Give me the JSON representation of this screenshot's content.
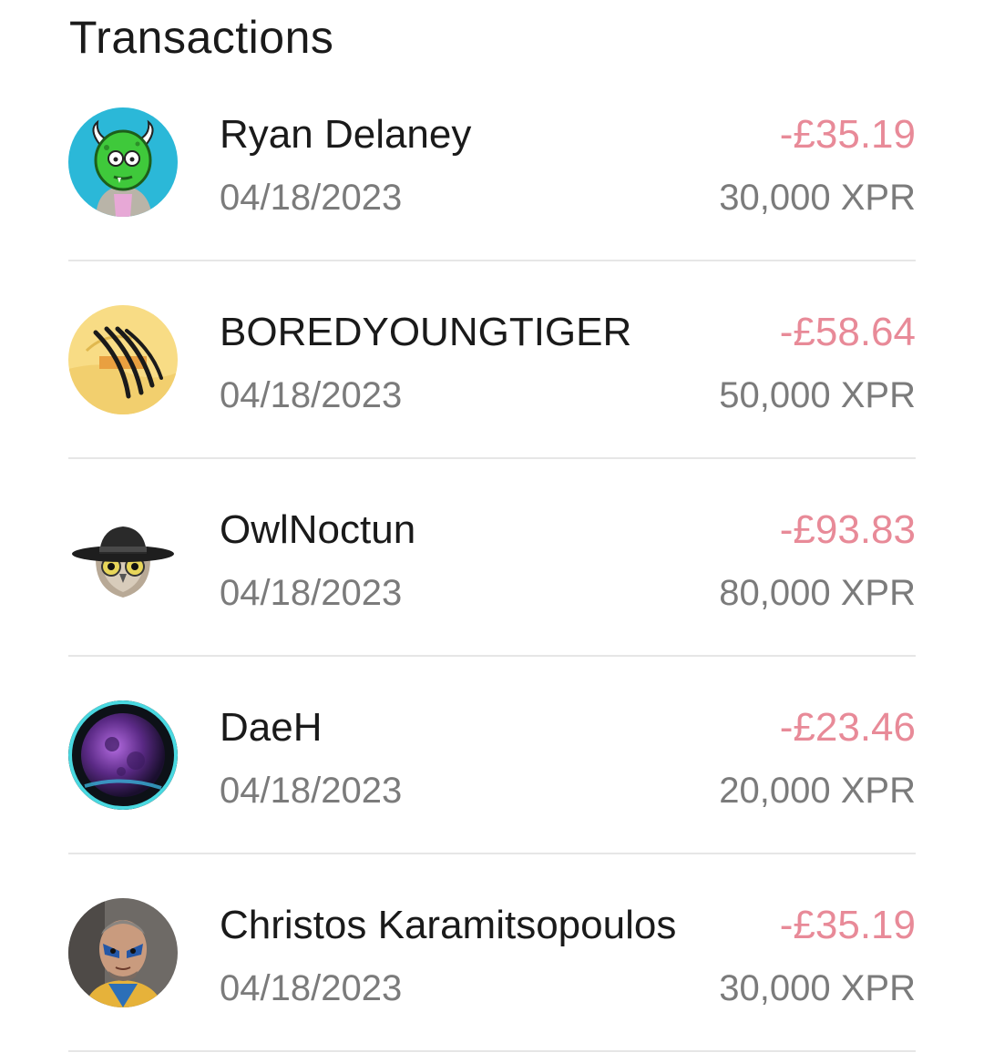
{
  "page": {
    "title": "Transactions"
  },
  "transactions": [
    {
      "name": "Ryan Delaney",
      "date": "04/18/2023",
      "amount": "-£35.19",
      "tokens": "30,000 XPR",
      "avatar_icon": "green-monster-avatar-icon"
    },
    {
      "name": "BOREDYOUNGTIGER",
      "date": "04/18/2023",
      "amount": "-£58.64",
      "tokens": "50,000 XPR",
      "avatar_icon": "tiger-claw-avatar-icon"
    },
    {
      "name": "OwlNoctun",
      "date": "04/18/2023",
      "amount": "-£93.83",
      "tokens": "80,000 XPR",
      "avatar_icon": "owl-cowboy-hat-avatar-icon"
    },
    {
      "name": "DaeH",
      "date": "04/18/2023",
      "amount": "-£23.46",
      "tokens": "20,000 XPR",
      "avatar_icon": "purple-moon-avatar-icon"
    },
    {
      "name": "Christos Karamitsopoulos",
      "date": "04/18/2023",
      "amount": "-£35.19",
      "tokens": "30,000 XPR",
      "avatar_icon": "painted-face-portrait-avatar-icon"
    }
  ],
  "colors": {
    "amount": "#e88a98",
    "secondary_text": "#7b7b7b",
    "primary_text": "#1a1a1a",
    "divider": "#e6e6e6"
  }
}
